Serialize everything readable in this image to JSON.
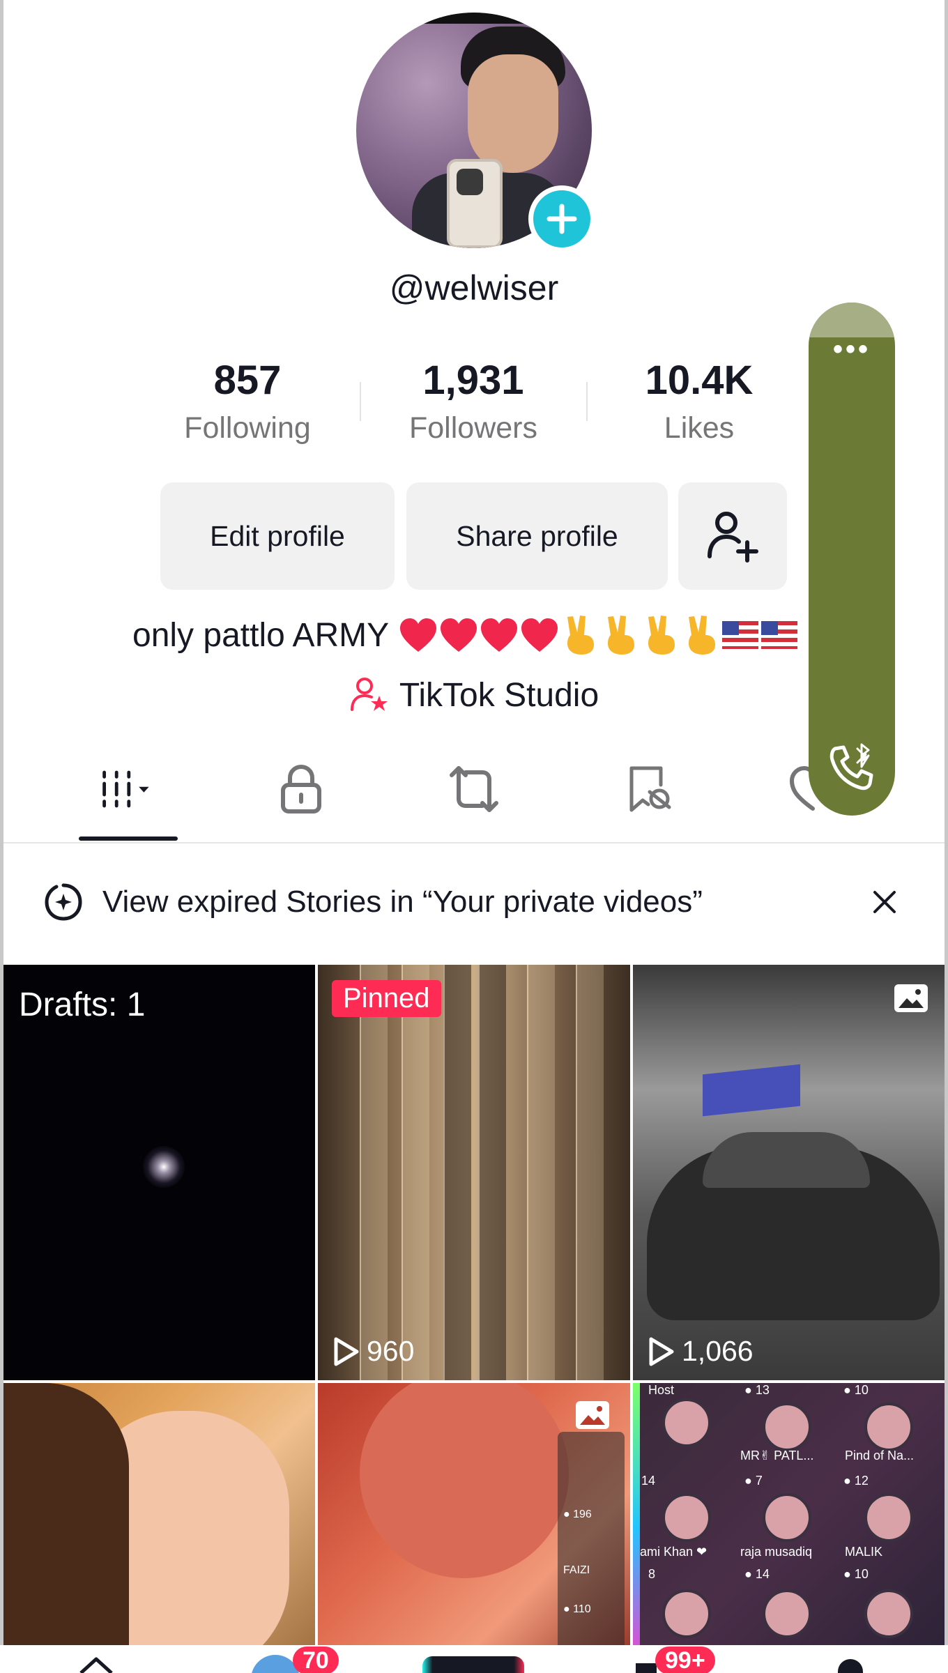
{
  "profile": {
    "username": "@welwiser",
    "stats": [
      {
        "value": "857",
        "label": "Following"
      },
      {
        "value": "1,931",
        "label": "Followers"
      },
      {
        "value": "10.4K",
        "label": "Likes"
      }
    ],
    "edit_label": "Edit profile",
    "share_label": "Share profile",
    "bio": "only pattlo ARMY",
    "bio_emojis": [
      "heart",
      "heart",
      "heart",
      "heart",
      "victory",
      "victory",
      "victory",
      "victory",
      "us-flag",
      "us-flag"
    ],
    "studio_label": "TikTok Studio"
  },
  "tabs": [
    {
      "icon": "grid-icon",
      "active": true
    },
    {
      "icon": "lock-icon"
    },
    {
      "icon": "repost-icon"
    },
    {
      "icon": "saved-icon"
    },
    {
      "icon": "liked-icon"
    }
  ],
  "floating_widget": {
    "dots": "•••",
    "icon": "bluetooth-call-icon",
    "color": "#6b7a34"
  },
  "banner": {
    "text": "View expired Stories in “Your private videos”"
  },
  "grid": [
    {
      "drafts_label": "Drafts: 1"
    },
    {
      "pinned_label": "Pinned",
      "views": "960"
    },
    {
      "views": "1,066",
      "type": "photo"
    },
    {},
    {
      "type": "photo",
      "overlay": [
        {
          "count": "196",
          "name": "FAIZI"
        },
        {
          "count": "110",
          "name": ""
        }
      ]
    },
    {
      "tiles": [
        {
          "count": "13",
          "name": "MR✌ PATL..."
        },
        {
          "count": "10",
          "name": "Pind of Na..."
        },
        {
          "count": "14",
          "name": "ami Khan ❤"
        },
        {
          "count": "7",
          "name": "raja musadiq"
        },
        {
          "count": "12",
          "name": "MALIK"
        },
        {
          "count": "8",
          "name": ""
        },
        {
          "count": "14",
          "name": ""
        },
        {
          "count": "10",
          "name": ""
        }
      ],
      "host_label": "Host"
    }
  ],
  "nav": {
    "friends_badge": "70",
    "inbox_badge": "99+"
  },
  "colors": {
    "accent": "#fe2c55",
    "cyan": "#20c4d9",
    "text": "#161823"
  }
}
